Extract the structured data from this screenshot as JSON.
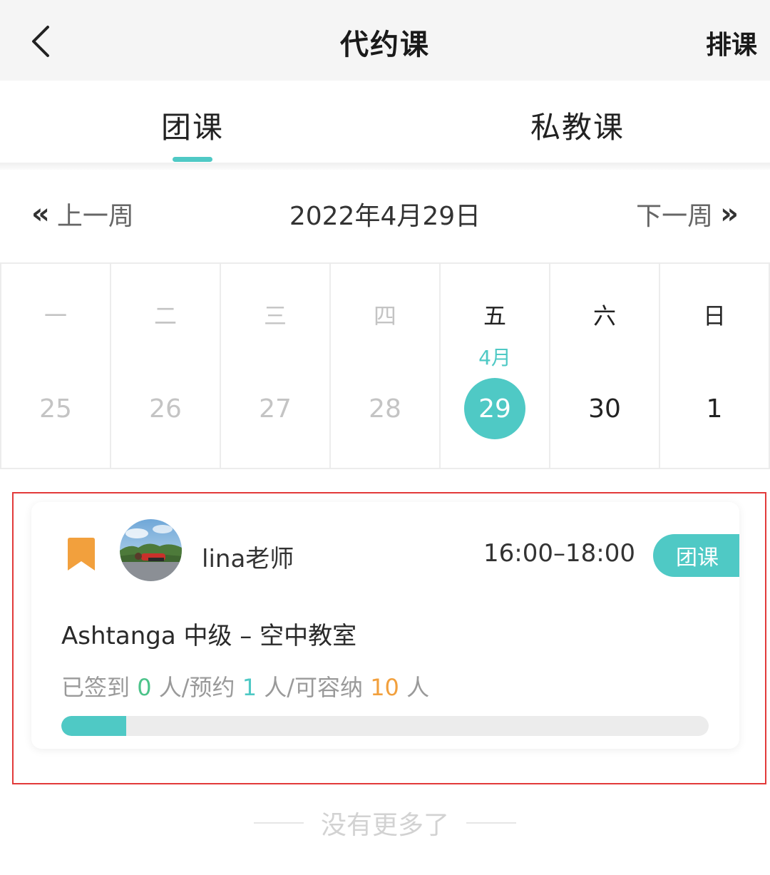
{
  "navbar": {
    "back_icon": "chevron-left-icon",
    "title": "代约课",
    "action_label": "排课"
  },
  "tabs": [
    {
      "label": "团课",
      "active": true
    },
    {
      "label": "私教课",
      "active": false
    }
  ],
  "week_nav": {
    "prev_icon": "double-chevron-left-icon",
    "prev_label": "上一周",
    "current_date": "2022年4月29日",
    "next_label": "下一周",
    "next_icon": "double-chevron-right-icon"
  },
  "calendar": {
    "days": [
      {
        "weekday": "一",
        "month": "",
        "date": "25",
        "state": "past"
      },
      {
        "weekday": "二",
        "month": "",
        "date": "26",
        "state": "past"
      },
      {
        "weekday": "三",
        "month": "",
        "date": "27",
        "state": "past"
      },
      {
        "weekday": "四",
        "month": "",
        "date": "28",
        "state": "past"
      },
      {
        "weekday": "五",
        "month": "4月",
        "date": "29",
        "state": "selected"
      },
      {
        "weekday": "六",
        "month": "",
        "date": "30",
        "state": "upcoming"
      },
      {
        "weekday": "日",
        "month": "",
        "date": "1",
        "state": "upcoming"
      }
    ]
  },
  "course": {
    "bookmark_icon": "bookmark-icon",
    "teacher": "lina老师",
    "time": "16:00–18:00",
    "type_badge": "团课",
    "name": "Ashtanga 中级 – 空中教室",
    "stats": {
      "signed_label": "已签到",
      "signed_count": "0",
      "unit1": "人/预约",
      "booked_count": "1",
      "unit2": "人/可容纳",
      "capacity": "10",
      "unit3": "人"
    },
    "progress_fraction": 0.1
  },
  "footer": {
    "no_more": "没有更多了"
  },
  "colors": {
    "accent": "#4fc9c5",
    "bookmark": "#f2a03d",
    "signed": "#4cc38a",
    "capacity": "#f2a03d",
    "highlight": "#e23a3a"
  }
}
